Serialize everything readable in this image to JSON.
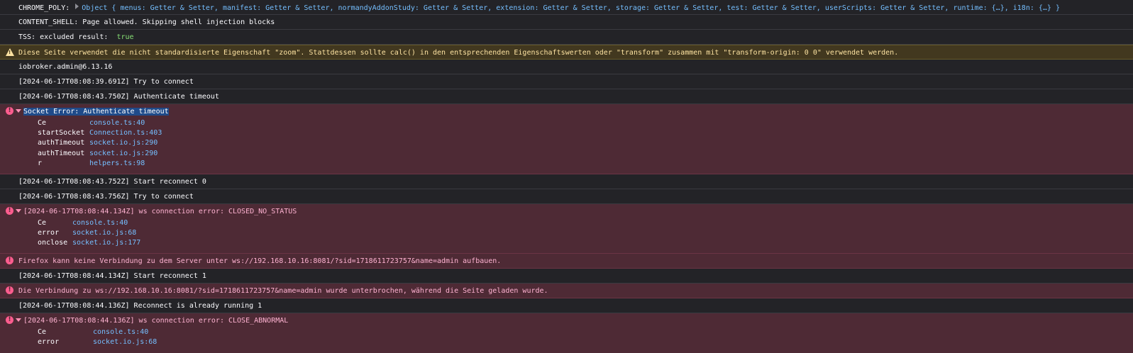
{
  "console": {
    "rows": [
      {
        "type": "log",
        "prefix": "CHROME_POLY: ",
        "object_preview": "Object { menus: Getter & Setter, manifest: Getter & Setter, normandyAddonStudy: Getter & Setter, extension: Getter & Setter, storage: Getter & Setter, test: Getter & Setter, userScripts: Getter & Setter, runtime: {…}, i18n: {…} }"
      },
      {
        "type": "log",
        "text": "CONTENT_SHELL: Page allowed. Skipping shell injection blocks"
      },
      {
        "type": "log",
        "prefix": "TSS: excluded result:  ",
        "value": "true"
      },
      {
        "type": "warn",
        "text": "Diese Seite verwendet die nicht standardisierte Eigenschaft \"zoom\". Stattdessen sollte calc() in den entsprechenden Eigenschaftswerten oder \"transform\" zusammen mit \"transform-origin: 0 0\" verwendet werden."
      },
      {
        "type": "log",
        "text": "iobroker.admin@6.13.16"
      },
      {
        "type": "log",
        "text": "[2024-06-17T08:08:39.691Z] Try to connect"
      },
      {
        "type": "log",
        "text": "[2024-06-17T08:08:43.750Z] Authenticate timeout"
      },
      {
        "type": "error",
        "text": "Socket Error: Authenticate timeout",
        "stack": [
          {
            "fn": "Ce",
            "loc": "console.ts:40"
          },
          {
            "fn": "startSocket",
            "loc": "Connection.ts:403"
          },
          {
            "fn": "authTimeout",
            "loc": "socket.io.js:290"
          },
          {
            "fn": "authTimeout",
            "loc": "socket.io.js:290"
          },
          {
            "fn": "r",
            "loc": "helpers.ts:98"
          }
        ]
      },
      {
        "type": "log",
        "text": "[2024-06-17T08:08:43.752Z] Start reconnect 0"
      },
      {
        "type": "log",
        "text": "[2024-06-17T08:08:43.756Z] Try to connect"
      },
      {
        "type": "error",
        "text": "[2024-06-17T08:08:44.134Z] ws connection error: CLOSED_NO_STATUS",
        "stack": [
          {
            "fn": "Ce",
            "loc": "console.ts:40"
          },
          {
            "fn": "error",
            "loc": "socket.io.js:68"
          },
          {
            "fn": "onclose",
            "loc": "socket.io.js:177"
          }
        ]
      },
      {
        "type": "error",
        "text": "Firefox kann keine Verbindung zu dem Server unter ws://192.168.10.16:8081/?sid=1718611723757&name=admin aufbauen."
      },
      {
        "type": "log",
        "text": "[2024-06-17T08:08:44.134Z] Start reconnect 1"
      },
      {
        "type": "error",
        "text": "Die Verbindung zu ws://192.168.10.16:8081/?sid=1718611723757&name=admin wurde unterbrochen, während die Seite geladen wurde."
      },
      {
        "type": "log",
        "text": "[2024-06-17T08:08:44.136Z] Reconnect is already running 1"
      },
      {
        "type": "error",
        "text": "[2024-06-17T08:08:44.136Z] ws connection error: CLOSE_ABNORMAL",
        "stack": [
          {
            "fn": "Ce",
            "loc": "console.ts:40"
          },
          {
            "fn": "error",
            "loc": "socket.io.js:68"
          }
        ]
      }
    ]
  },
  "icons": {
    "error": "error-icon",
    "warning": "warning-icon",
    "expand": "expand-triangle-icon",
    "collapse": "collapse-triangle-icon"
  },
  "colors": {
    "background": "#232327",
    "error_background": "#4e2a35",
    "warning_background": "#42381f",
    "link": "#75bfff",
    "boolean": "#86de74",
    "error_icon": "#ff5d8f"
  }
}
